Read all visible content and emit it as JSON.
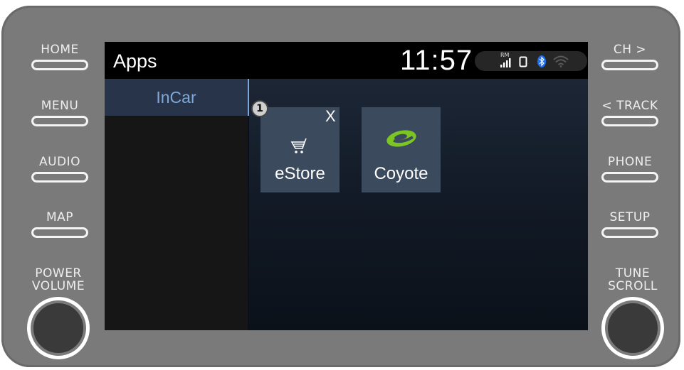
{
  "hardware": {
    "left_buttons": [
      "HOME",
      "MENU",
      "AUDIO",
      "MAP"
    ],
    "right_buttons": [
      "CH >",
      "< TRACK",
      "PHONE",
      "SETUP"
    ],
    "left_knob_label": [
      "POWER",
      "VOLUME"
    ],
    "right_knob_label": [
      "TUNE",
      "SCROLL"
    ]
  },
  "status_bar": {
    "title": "Apps",
    "time": "11:57",
    "rm_label": "RM",
    "icons": [
      "signal-icon",
      "phone-battery-icon",
      "bluetooth-icon",
      "wifi-icon"
    ],
    "bluetooth_color": "#1e6ff0"
  },
  "sidebar": {
    "items": [
      {
        "label": "InCar",
        "selected": true
      }
    ]
  },
  "apps": [
    {
      "label": "eStore",
      "icon": "shopping-cart-icon",
      "badge": "1",
      "close_label": "X"
    },
    {
      "label": "Coyote",
      "icon": "coyote-logo-icon",
      "icon_color": "#7cc623"
    }
  ],
  "colors": {
    "bezel": "#7a7a7a",
    "accent": "#7fa8d8",
    "tile": "#3b4a5c"
  }
}
